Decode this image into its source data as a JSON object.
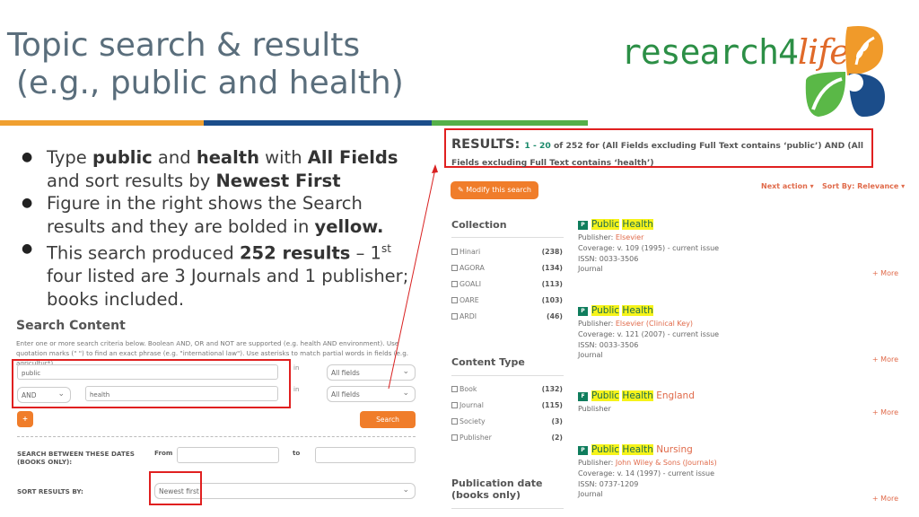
{
  "slide": {
    "title_line1": "Topic search & results",
    "title_line2": "(e.g., public and health)",
    "stripe_colors": [
      "#f0a030",
      "#1b4d8a",
      "#54b049"
    ]
  },
  "logo": {
    "word": "research4",
    "life": "life",
    "colors": {
      "green": "#2c8f46",
      "orange": "#f09a2a",
      "blue": "#1b4d8a",
      "leaf": "#5ab847"
    }
  },
  "bullets": [
    {
      "parts": [
        [
          "Type ",
          false
        ],
        [
          "public",
          true
        ],
        [
          " and ",
          false
        ],
        [
          "health",
          true
        ],
        [
          " with ",
          false
        ],
        [
          "All Fields",
          true
        ],
        [
          " and sort results by ",
          false
        ],
        [
          "Newest First",
          true
        ]
      ]
    },
    {
      "parts": [
        [
          "Figure in the right shows the Search results and they are bolded in ",
          false
        ],
        [
          "yellow.",
          true
        ]
      ]
    },
    {
      "parts": [
        [
          "This search produced ",
          false
        ],
        [
          "252 results",
          true
        ],
        [
          " – 1",
          false
        ],
        [
          "st",
          "sup"
        ],
        [
          " four listed are 3 Journals and 1 publisher; books included.",
          false
        ]
      ]
    }
  ],
  "search_content": {
    "heading": "Search Content",
    "help": "Enter one or more search criteria below. Boolean AND, OR and NOT are supported (e.g. health AND environment). Use quotation marks (\" \") to find an exact phrase (e.g. \"international law\"). Use asterisks to match partial words in fields (e.g. agricultur*).",
    "row1_value": "public",
    "row2_operator": "AND",
    "row2_value": "health",
    "in_label": "in",
    "field1": "All fields",
    "field2": "All fields",
    "add_label": "+",
    "search_label": "Search",
    "dates_label_1": "SEARCH BETWEEN THESE DATES",
    "dates_label_2": "(BOOKS ONLY):",
    "from_label": "From",
    "to_label": "to",
    "from_value": "",
    "to_value": "",
    "sort_label": "SORT RESULTS BY:",
    "sort_value": "Newest first"
  },
  "results": {
    "label": "RESULTS:",
    "range_start": "1",
    "range_sep": " - ",
    "range_end": "20",
    "summary": " of 252 for (All Fields excluding Full Text contains ‘public’) AND (All Fields excluding Full Text contains ‘health’)",
    "modify_label": "Modify this search",
    "next_action": "Next action ▾",
    "sort_by": "Sort By: Relevance ▾"
  },
  "facets": {
    "collection": {
      "heading": "Collection",
      "items": [
        {
          "label": "Hinari",
          "count": "(238)"
        },
        {
          "label": "AGORA",
          "count": "(134)"
        },
        {
          "label": "GOALI",
          "count": "(113)"
        },
        {
          "label": "OARE",
          "count": "(103)"
        },
        {
          "label": "ARDI",
          "count": "(46)"
        }
      ]
    },
    "content_type": {
      "heading": "Content Type",
      "items": [
        {
          "label": "Book",
          "count": "(132)"
        },
        {
          "label": "Journal",
          "count": "(115)"
        },
        {
          "label": "Society",
          "count": "(3)"
        },
        {
          "label": "Publisher",
          "count": "(2)"
        }
      ]
    },
    "pub_date": {
      "heading_1": "Publication date",
      "heading_2": "(books only)"
    }
  },
  "items": [
    {
      "badge": "P",
      "hl1": "Public",
      "hl2": "Health",
      "tail": "",
      "publisher_label": "Publisher: ",
      "publisher": "Elsevier",
      "coverage": "Coverage: v. 109 (1995) - current issue",
      "issn": "ISSN: 0033-3506",
      "type": "Journal",
      "more": "+ More"
    },
    {
      "badge": "P",
      "hl1": "Public",
      "hl2": "Health",
      "tail": "",
      "publisher_label": "Publisher: ",
      "publisher": "Elsevier (Clinical Key)",
      "coverage": "Coverage: v. 121 (2007) - current issue",
      "issn": "ISSN: 0033-3506",
      "type": "Journal",
      "more": "+ More"
    },
    {
      "badge": "F",
      "hl1": "Public",
      "hl2": "Health",
      "tail": " England",
      "type": "Publisher",
      "more": "+ More"
    },
    {
      "badge": "P",
      "hl1": "Public",
      "hl2": "Health",
      "tail": " Nursing",
      "publisher_label": "Publisher: ",
      "publisher": "John Wiley & Sons (Journals)",
      "coverage": "Coverage: v. 14 (1997) - current issue",
      "issn": "ISSN: 0737-1209",
      "type": "Journal",
      "more": "+ More"
    }
  ]
}
